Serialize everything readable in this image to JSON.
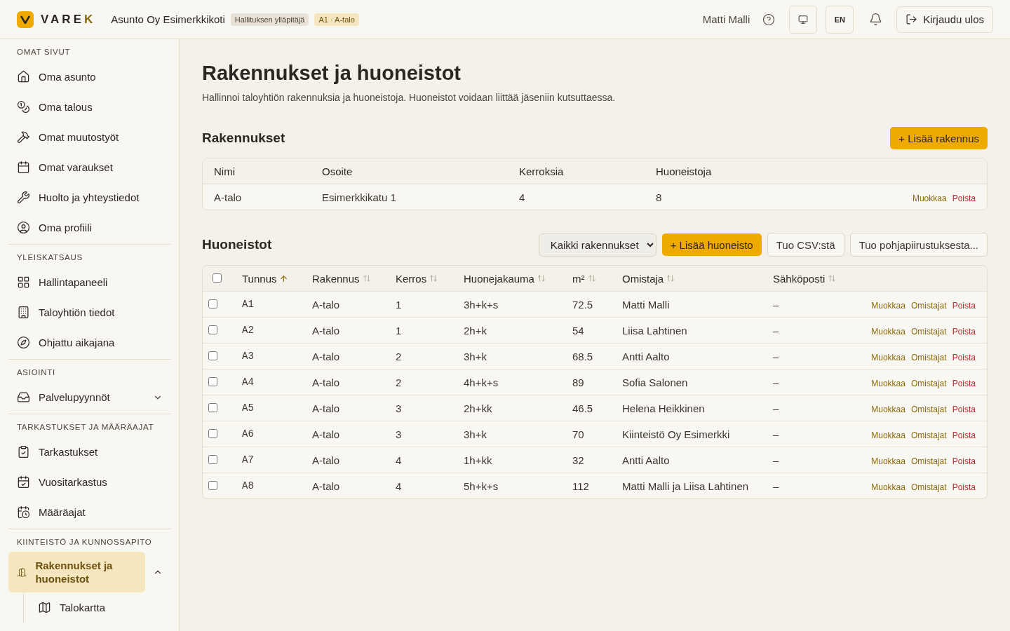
{
  "header": {
    "logo": {
      "text": "VARE",
      "accent": "K"
    },
    "organization": "Asunto Oy Esimerkkikoti",
    "badges": [
      {
        "text": "Hallituksen ylläpitäjä",
        "kind": "role"
      },
      {
        "text": "A1 · A-talo",
        "kind": "unit"
      }
    ],
    "user": "Matti Malli",
    "language": "EN",
    "logout": "Kirjaudu ulos"
  },
  "sidebar": {
    "sections": [
      {
        "title": "OMAT SIVUT",
        "items": [
          {
            "label": "Oma asunto",
            "selected": false
          },
          {
            "label": "Oma talous",
            "selected": false
          },
          {
            "label": "Omat muutostyöt",
            "selected": false
          },
          {
            "label": "Omat varaukset",
            "selected": false
          },
          {
            "label": "Huolto ja yhteystiedot",
            "selected": false
          },
          {
            "label": "Oma profiili",
            "selected": false
          }
        ]
      },
      {
        "title": "YLEISKATSAUS",
        "items": [
          {
            "label": "Hallintapaneeli",
            "selected": false
          },
          {
            "label": "Taloyhtiön tiedot",
            "selected": false
          },
          {
            "label": "Ohjattu aikajana",
            "selected": false
          }
        ]
      },
      {
        "title": "ASIOINTI",
        "items": [
          {
            "label": "Palvelupyynnöt",
            "selected": false,
            "expanded": false
          }
        ]
      },
      {
        "title": "TARKASTUKSET JA MÄÄRÄAJAT",
        "items": [
          {
            "label": "Tarkastukset",
            "selected": false
          },
          {
            "label": "Vuositarkastus",
            "selected": false
          },
          {
            "label": "Määräajat",
            "selected": false
          }
        ]
      },
      {
        "title": "KIINTEISTÖ JA KUNNOSSAPITO",
        "items": [
          {
            "label": "Rakennukset ja huoneistot",
            "selected": true,
            "expanded": true,
            "children": [
              {
                "label": "Talokartta",
                "selected": false
              }
            ]
          }
        ]
      }
    ]
  },
  "page": {
    "title": "Rakennukset ja huoneistot",
    "description": "Hallinnoi taloyhtiön rakennuksia ja huoneistoja. Huoneistot voidaan liittää jäseniin kutsuttaessa."
  },
  "buildings": {
    "title": "Rakennukset",
    "add_button": "+ Lisää rakennus",
    "columns": [
      "Nimi",
      "Osoite",
      "Kerroksia",
      "Huoneistoja"
    ],
    "rows": [
      {
        "cells": [
          "A-talo",
          "Esimerkkikatu 1",
          "4",
          "8"
        ],
        "actions": [
          {
            "label": "Muokkaa",
            "kind": "edit"
          },
          {
            "label": "Poista",
            "kind": "delete"
          }
        ]
      }
    ]
  },
  "apartments": {
    "title": "Huoneistot",
    "filter": "Kaikki rakennukset",
    "add_button": "+ Lisää huoneisto",
    "import_buttons": [
      "Tuo CSV:stä",
      "Tuo pohjapiirustuksesta..."
    ],
    "all_checked": false,
    "columns": [
      {
        "label": "Tunnus",
        "sorted": true
      },
      {
        "label": "Rakennus",
        "sorted": false
      },
      {
        "label": "Kerros",
        "sorted": false
      },
      {
        "label": "Huonejakauma",
        "sorted": false
      },
      {
        "label": "m²",
        "sorted": false
      },
      {
        "label": "Omistaja",
        "sorted": false
      },
      {
        "label": "Sähköposti",
        "sorted": false
      }
    ],
    "rows": [
      {
        "checked": false,
        "cells": [
          "A1",
          "A-talo",
          "1",
          "3h+k+s",
          "72.5",
          "Matti Malli",
          "–"
        ],
        "actions": [
          {
            "label": "Muokkaa",
            "kind": "edit"
          },
          {
            "label": "Omistajat",
            "kind": "owners"
          },
          {
            "label": "Poista",
            "kind": "delete"
          }
        ]
      },
      {
        "checked": false,
        "cells": [
          "A2",
          "A-talo",
          "1",
          "2h+k",
          "54",
          "Liisa Lahtinen",
          "–"
        ],
        "actions": [
          {
            "label": "Muokkaa",
            "kind": "edit"
          },
          {
            "label": "Omistajat",
            "kind": "owners"
          },
          {
            "label": "Poista",
            "kind": "delete"
          }
        ]
      },
      {
        "checked": false,
        "cells": [
          "A3",
          "A-talo",
          "2",
          "3h+k",
          "68.5",
          "Antti Aalto",
          "–"
        ],
        "actions": [
          {
            "label": "Muokkaa",
            "kind": "edit"
          },
          {
            "label": "Omistajat",
            "kind": "owners"
          },
          {
            "label": "Poista",
            "kind": "delete"
          }
        ]
      },
      {
        "checked": false,
        "cells": [
          "A4",
          "A-talo",
          "2",
          "4h+k+s",
          "89",
          "Sofia Salonen",
          "–"
        ],
        "actions": [
          {
            "label": "Muokkaa",
            "kind": "edit"
          },
          {
            "label": "Omistajat",
            "kind": "owners"
          },
          {
            "label": "Poista",
            "kind": "delete"
          }
        ]
      },
      {
        "checked": false,
        "cells": [
          "A5",
          "A-talo",
          "3",
          "2h+kk",
          "46.5",
          "Helena Heikkinen",
          "–"
        ],
        "actions": [
          {
            "label": "Muokkaa",
            "kind": "edit"
          },
          {
            "label": "Omistajat",
            "kind": "owners"
          },
          {
            "label": "Poista",
            "kind": "delete"
          }
        ]
      },
      {
        "checked": false,
        "cells": [
          "A6",
          "A-talo",
          "3",
          "3h+k",
          "70",
          "Kiinteistö Oy Esimerkki",
          "–"
        ],
        "actions": [
          {
            "label": "Muokkaa",
            "kind": "edit"
          },
          {
            "label": "Omistajat",
            "kind": "owners"
          },
          {
            "label": "Poista",
            "kind": "delete"
          }
        ]
      },
      {
        "checked": false,
        "cells": [
          "A7",
          "A-talo",
          "4",
          "1h+kk",
          "32",
          "Antti Aalto",
          "–"
        ],
        "actions": [
          {
            "label": "Muokkaa",
            "kind": "edit"
          },
          {
            "label": "Omistajat",
            "kind": "owners"
          },
          {
            "label": "Poista",
            "kind": "delete"
          }
        ]
      },
      {
        "checked": false,
        "cells": [
          "A8",
          "A-talo",
          "4",
          "5h+k+s",
          "112",
          "Matti Malli ja Liisa Lahtinen",
          "–"
        ],
        "actions": [
          {
            "label": "Muokkaa",
            "kind": "edit"
          },
          {
            "label": "Omistajat",
            "kind": "owners"
          },
          {
            "label": "Poista",
            "kind": "delete"
          }
        ]
      }
    ]
  }
}
